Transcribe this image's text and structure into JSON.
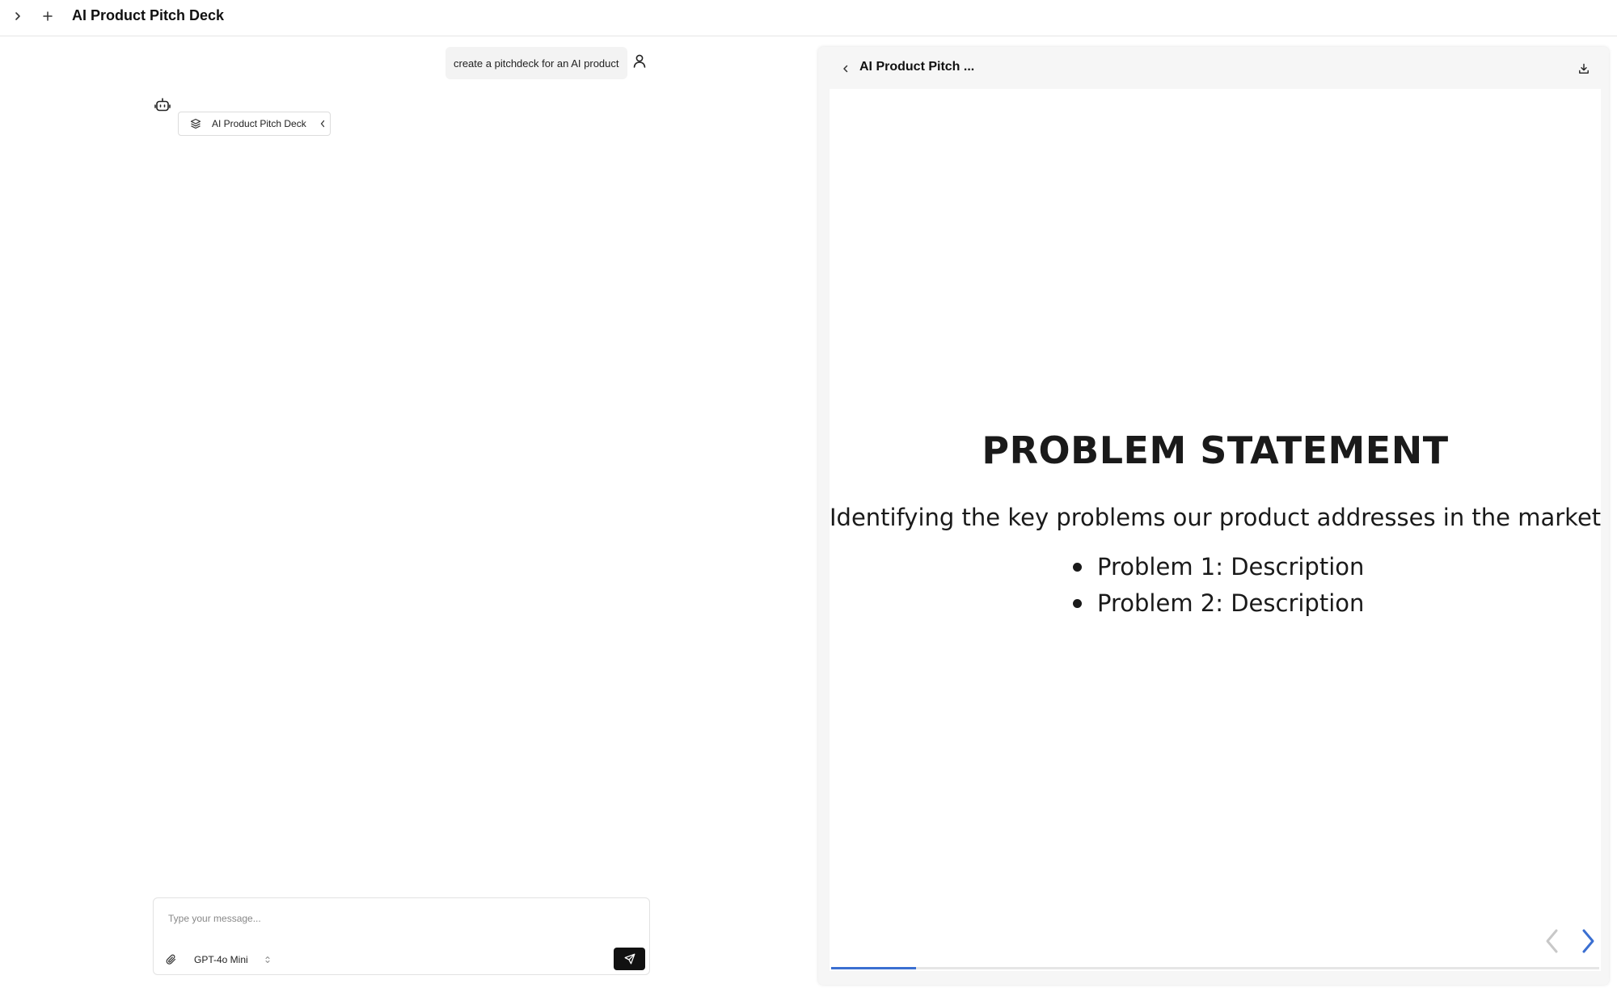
{
  "header": {
    "title": "AI Product Pitch Deck",
    "expand_icon": "chevron-right-icon",
    "new_chat_icon": "plus-icon"
  },
  "chat": {
    "user_message": "create a pitchdeck for an AI product",
    "user_avatar_icon": "user-icon",
    "bot_avatar_icon": "bot-icon",
    "artifact_chip": {
      "label": "AI Product Pitch Deck",
      "icon": "layers-icon",
      "chevron_icon": "chevron-left-icon"
    }
  },
  "composer": {
    "placeholder": "Type your message...",
    "value": "",
    "attach_icon": "paperclip-icon",
    "model": "GPT-4o Mini",
    "model_toggle_icon": "chevron-up-down-icon",
    "send_icon": "send-icon"
  },
  "artifact_panel": {
    "title": "AI Product Pitch ...",
    "back_icon": "chevron-left-icon",
    "download_icon": "download-icon",
    "slide": {
      "heading": "PROBLEM STATEMENT",
      "subheading": "Identifying the key problems our product addresses in the market.",
      "bullets": [
        "Problem 1: Description",
        "Problem 2: Description"
      ]
    },
    "nav": {
      "prev_icon": "chevron-left-icon",
      "next_icon": "chevron-right-icon"
    },
    "progress_fraction": 0.11,
    "colors": {
      "progress": "#3b6fd1",
      "next_arrow": "#3b6fd1",
      "prev_arrow_disabled": "#c8c8c8"
    }
  }
}
